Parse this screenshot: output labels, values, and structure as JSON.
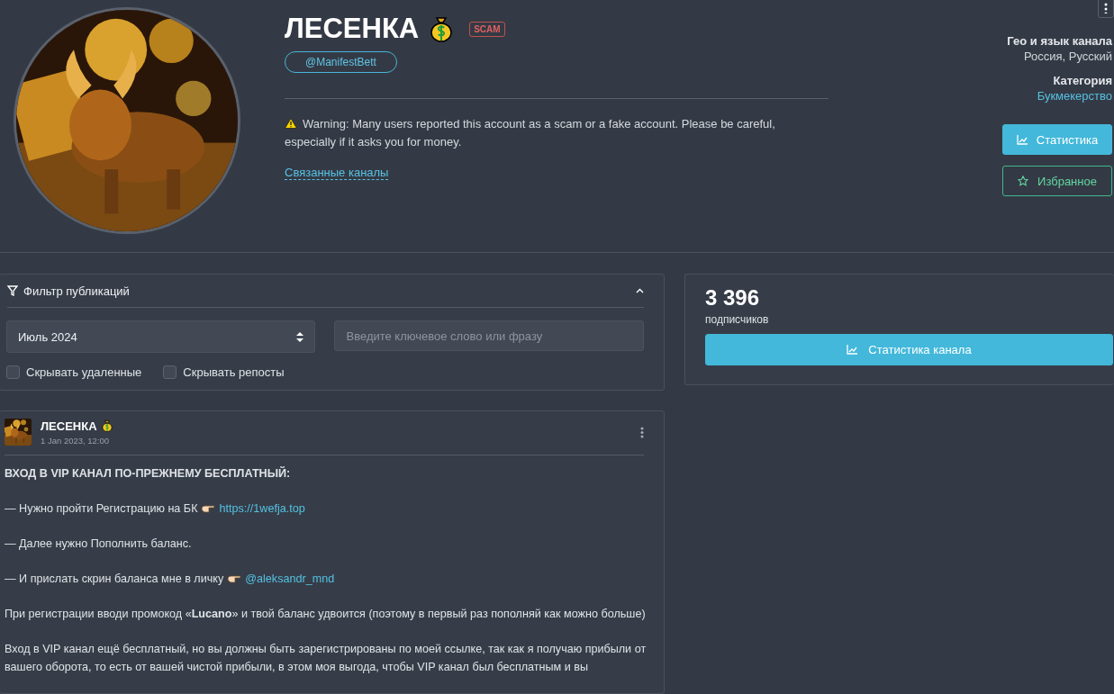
{
  "channel": {
    "kind": "picture",
    "title": "ЛЕСЕНКА",
    "badge": "SCAM",
    "username": "@ManifestBett",
    "warning": "Warning: Many users reported this account as a scam or a fake account. Please be careful, especially if it asks you for money.",
    "related_link": "Связанные каналы"
  },
  "info": [
    {
      "label": "Гео и язык канала",
      "value": "Россия, Русский",
      "kind": "plain"
    },
    {
      "label": "Категория",
      "value": "Букмекерство",
      "kind": "link"
    }
  ],
  "actions": [
    {
      "label": "Статистика",
      "kind": "primary"
    },
    {
      "label": "Избранное",
      "kind": "outline"
    }
  ],
  "filter": {
    "title": "Фильтр публикаций",
    "expanded": true,
    "month": "Июль 2024",
    "search_placeholder": "Введите ключевое слово или фразу",
    "options": [
      {
        "label": "Скрывать удаленные",
        "checked": false
      },
      {
        "label": "Скрывать репосты",
        "checked": false
      }
    ]
  },
  "stats": {
    "count": "3 396",
    "label": "подписчиков",
    "button": "Статистика канала"
  },
  "post": {
    "author": "ЛЕСЕНКА",
    "date": "1 Jan 2023, 12:00",
    "paragraphs": [
      {
        "kind": "heading",
        "text": "ВХОД В VIP КАНАЛ ПО-ПРЕЖНЕМУ БЕСПЛАТНЫЙ:"
      },
      {
        "kind": "text",
        "text": "— Нужно пройти Регистрацию на БК",
        "pointer": true,
        "link": "https://1wefja.top"
      },
      {
        "kind": "text",
        "text": "— Далее нужно Пополнить баланс."
      },
      {
        "kind": "text",
        "text": "— И прислать скрин баланса мне в личку",
        "pointer": true,
        "link": "@aleksandr_mnd"
      },
      {
        "kind": "text",
        "text": "При регистрации вводи промокод «**Lucano**» и твой баланс удвоится (поэтому в первый раз пополняй как можно больше)"
      },
      {
        "kind": "text",
        "text": "Вход в VIP канал ещё бесплатный, но вы должны быть зарегистрированы по моей ссылке, так как я получаю прибыли от вашего оборота, то есть от вашей чистой прибыли, в этом моя выгода, чтобы VIP канал был бесплатным и вы"
      }
    ]
  }
}
